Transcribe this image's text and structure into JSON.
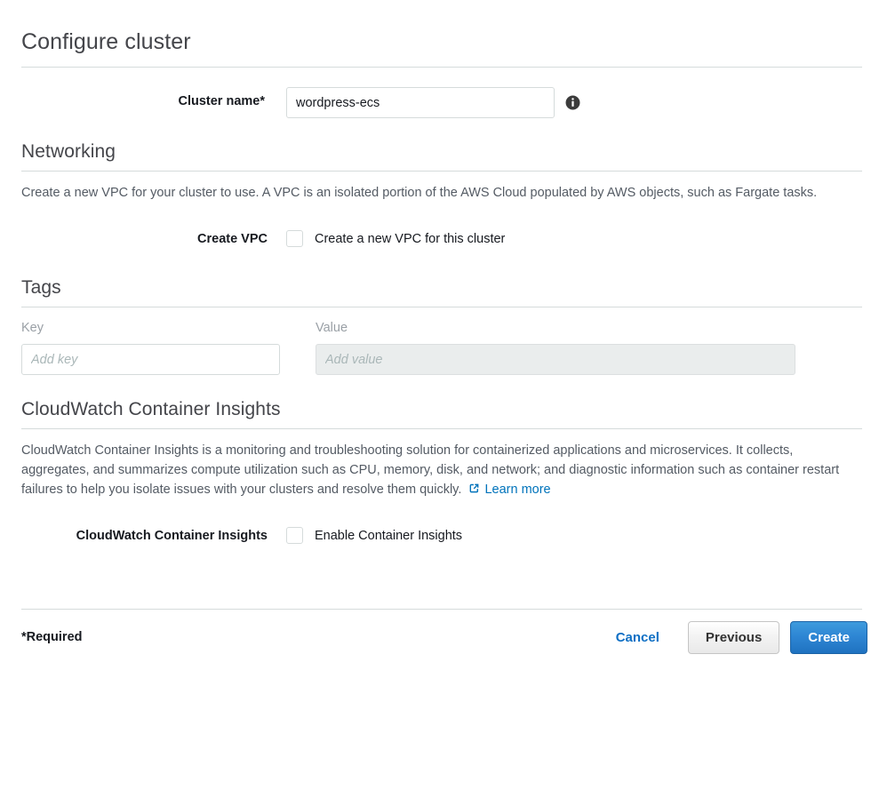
{
  "page": {
    "title": "Configure cluster"
  },
  "cluster_name": {
    "label": "Cluster name*",
    "value": "wordpress-ecs",
    "info_icon": "info-icon"
  },
  "networking": {
    "title": "Networking",
    "description": "Create a new VPC for your cluster to use. A VPC is an isolated portion of the AWS Cloud populated by AWS objects, such as Fargate tasks.",
    "create_vpc_label": "Create VPC",
    "create_vpc_checkbox_text": "Create a new VPC for this cluster",
    "create_vpc_checked": false
  },
  "tags": {
    "title": "Tags",
    "key_header": "Key",
    "value_header": "Value",
    "key_placeholder": "Add key",
    "value_placeholder": "Add value",
    "key_value": "",
    "value_value": "",
    "value_disabled": true
  },
  "container_insights": {
    "title": "CloudWatch Container Insights",
    "description": "CloudWatch Container Insights is a monitoring and troubleshooting solution for containerized applications and microservices. It collects, aggregates, and summarizes compute utilization such as CPU, memory, disk, and network; and diagnostic information such as container restart failures to help you isolate issues with your clusters and resolve them quickly.",
    "learn_more_label": "Learn more",
    "learn_more_icon": "external-link-icon",
    "field_label": "CloudWatch Container Insights",
    "checkbox_text": "Enable Container Insights",
    "checked": false
  },
  "footer": {
    "required_note": "*Required",
    "cancel_label": "Cancel",
    "previous_label": "Previous",
    "create_label": "Create"
  },
  "colors": {
    "link_blue": "#0073bb",
    "primary_button_blue": "#2e86d4",
    "heading_gray": "#44454a",
    "body_gray": "#545b64",
    "border_gray": "#d5dbdb",
    "disabled_fill": "#eaeded"
  }
}
